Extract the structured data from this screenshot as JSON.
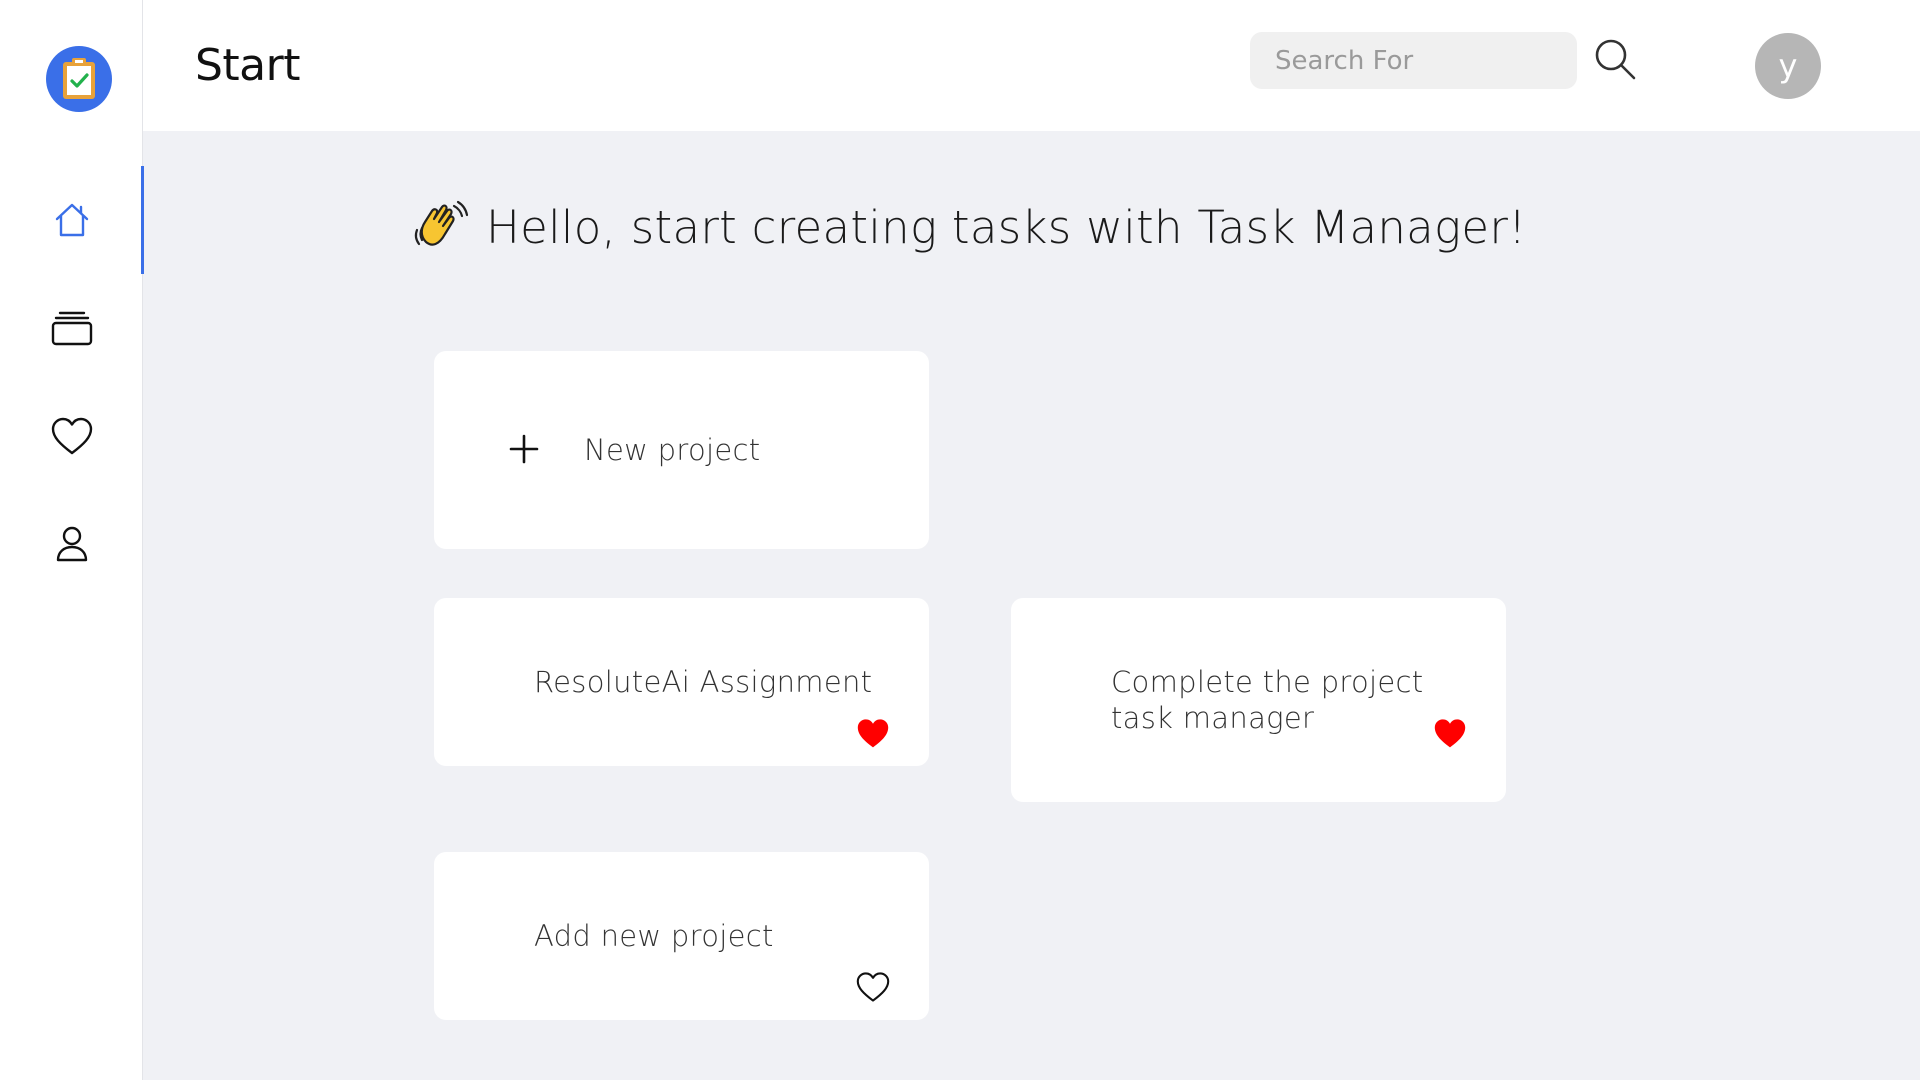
{
  "header": {
    "title": "Start",
    "search_placeholder": "Search For",
    "avatar_initial": "y"
  },
  "sidebar": {
    "items": [
      {
        "name": "home",
        "icon": "home-icon",
        "active": true
      },
      {
        "name": "projects",
        "icon": "stack-icon",
        "active": false
      },
      {
        "name": "favorites",
        "icon": "heart-icon",
        "active": false
      },
      {
        "name": "profile",
        "icon": "user-icon",
        "active": false
      }
    ]
  },
  "main": {
    "greeting": "Hello, start creating tasks with Task Manager!",
    "new_project_label": "New project",
    "projects": [
      {
        "title": "ResoluteAi Assignment",
        "favorite": true
      },
      {
        "title": "Complete the project task manager",
        "favorite": true
      },
      {
        "title": "Add new project",
        "favorite": false
      }
    ]
  },
  "colors": {
    "accent": "#3a6fe8",
    "favorite": "#ff0000",
    "background": "#f0f1f5"
  }
}
